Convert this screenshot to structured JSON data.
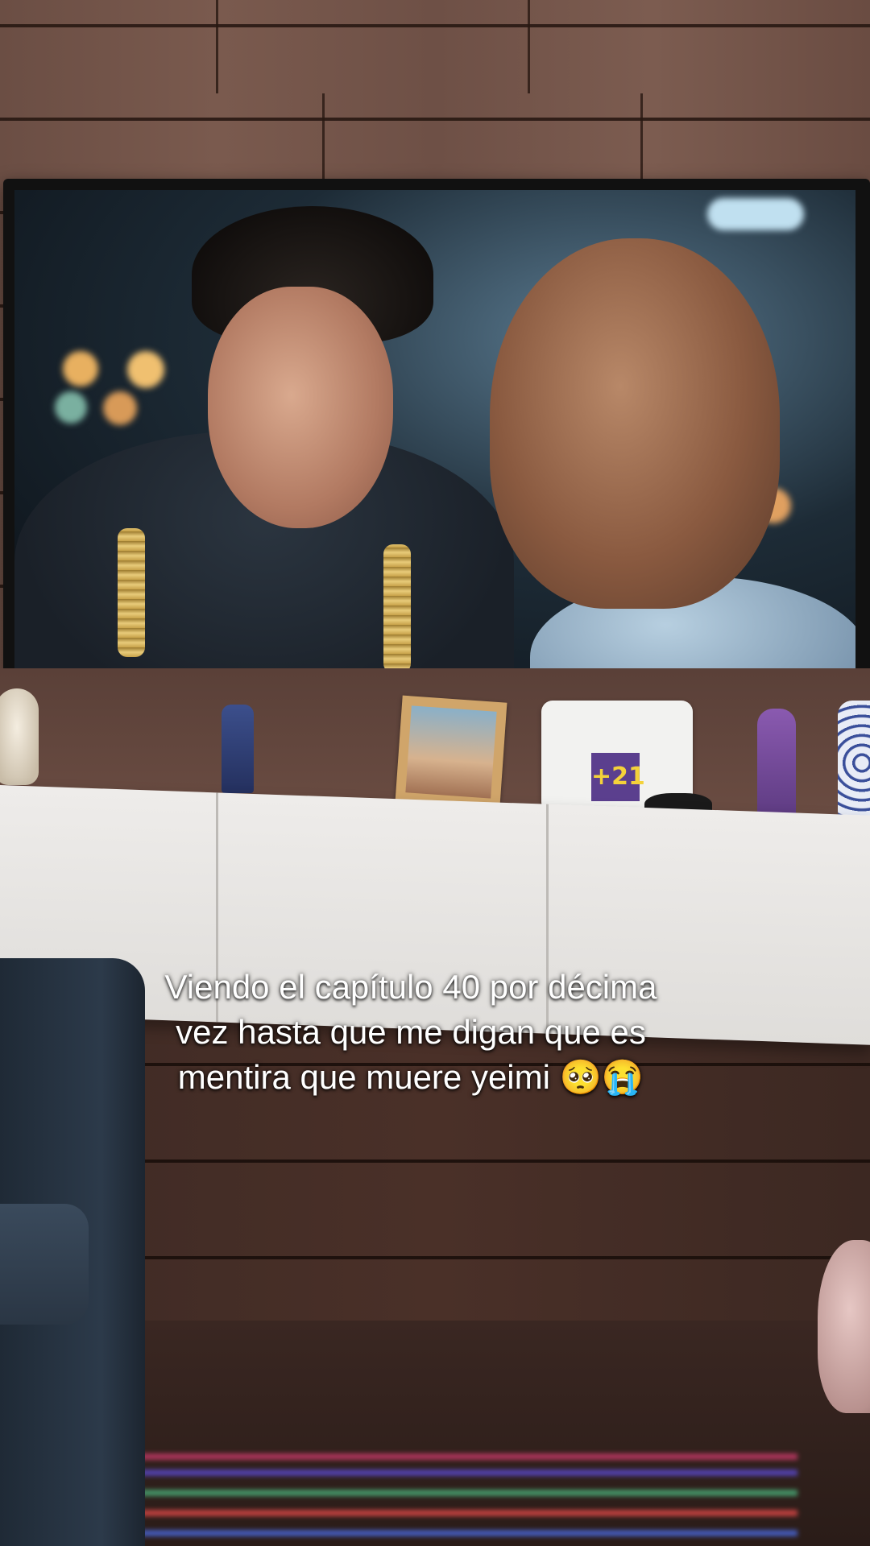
{
  "caption": {
    "line1": "Viendo el capítulo 40 por décima",
    "line2": "vez hasta que me digan que es",
    "line3": "mentira que muere yeimi 🥺😭"
  },
  "scene": {
    "router_label": "+21",
    "accent_colors": {
      "wall_wood": "#6b4e44",
      "cabinet_white": "#eeecea",
      "router_badge": "#5b3f8e",
      "router_badge_text": "#f4d23a"
    }
  }
}
